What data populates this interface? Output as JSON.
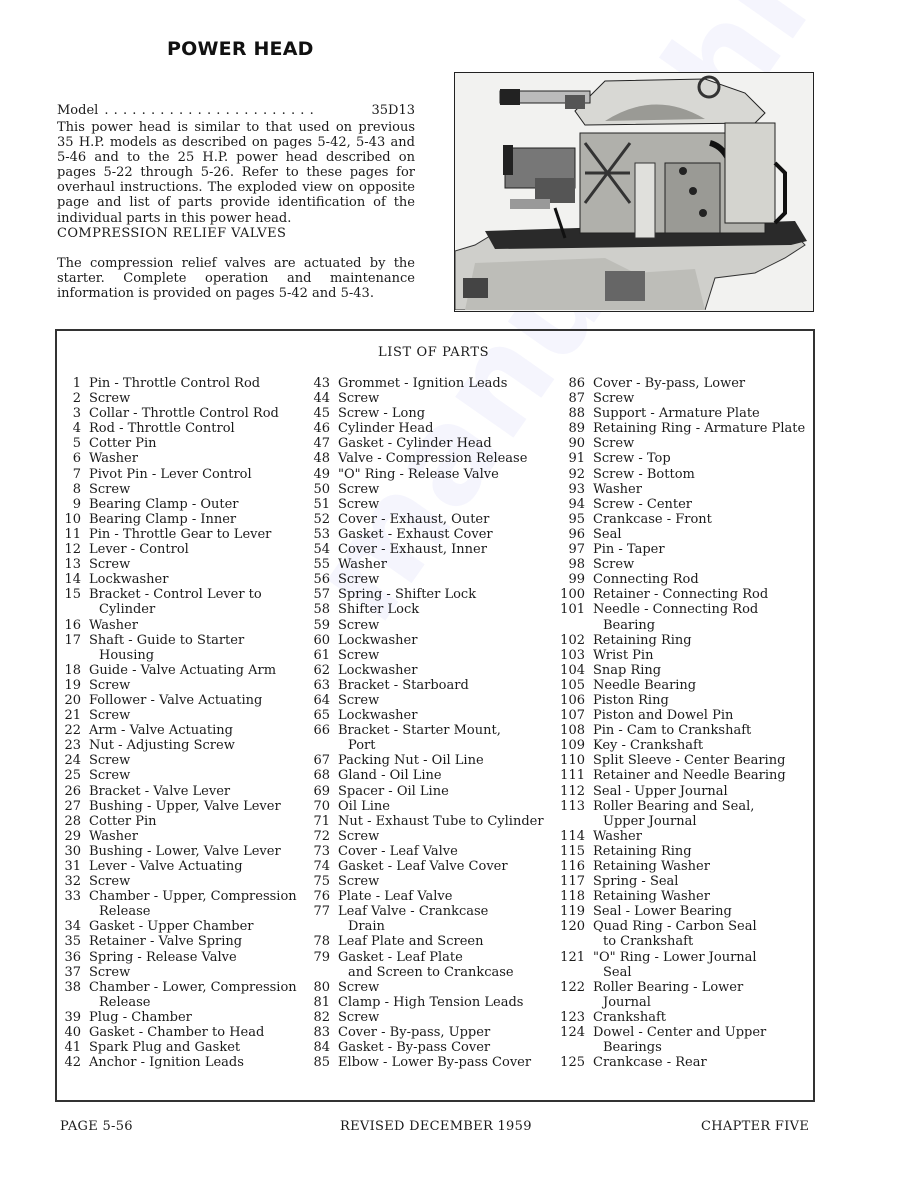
{
  "page": {
    "title": "POWER HEAD",
    "model": {
      "label": "Model",
      "dots": ".......................",
      "value": "35D13"
    },
    "intro_text": "This power head is similar to that used on previous 35 H.P. models as described on pages 5-42, 5-43 and 5-46 and to the 25 H.P. power head described on pages 5-22 through 5-26. Refer to these pages for overhaul instructions. The exploded view on opposite page and list of parts provide identification of the individual parts in this power head.",
    "section": {
      "heading": "COMPRESSION RELIEF VALVES",
      "body": "The compression relief valves are actuated by the starter. Complete operation and maintenance information is provided on pages 5-42 and 5-43."
    },
    "photo": {
      "subject": "outboard-motor-power-head-photo"
    },
    "watermark": "manualshive"
  },
  "parts_list": {
    "title": "LIST OF PARTS",
    "columns": [
      [
        {
          "n": "1",
          "d": "Pin - Throttle Control Rod"
        },
        {
          "n": "2",
          "d": "Screw"
        },
        {
          "n": "3",
          "d": "Collar - Throttle Control Rod"
        },
        {
          "n": "4",
          "d": "Rod - Throttle Control"
        },
        {
          "n": "5",
          "d": "Cotter Pin"
        },
        {
          "n": "6",
          "d": "Washer"
        },
        {
          "n": "7",
          "d": "Pivot Pin - Lever Control"
        },
        {
          "n": "8",
          "d": "Screw"
        },
        {
          "n": "9",
          "d": "Bearing Clamp - Outer"
        },
        {
          "n": "10",
          "d": "Bearing Clamp - Inner"
        },
        {
          "n": "11",
          "d": "Pin - Throttle Gear to Lever"
        },
        {
          "n": "12",
          "d": "Lever - Control"
        },
        {
          "n": "13",
          "d": "Screw"
        },
        {
          "n": "14",
          "d": "Lockwasher"
        },
        {
          "n": "15",
          "d": "Bracket - Control Lever to",
          "c": "Cylinder"
        },
        {
          "n": "16",
          "d": "Washer"
        },
        {
          "n": "17",
          "d": "Shaft - Guide to Starter",
          "c": "Housing"
        },
        {
          "n": "18",
          "d": "Guide - Valve Actuating Arm"
        },
        {
          "n": "19",
          "d": "Screw"
        },
        {
          "n": "20",
          "d": "Follower - Valve Actuating"
        },
        {
          "n": "21",
          "d": "Screw"
        },
        {
          "n": "22",
          "d": "Arm - Valve Actuating"
        },
        {
          "n": "23",
          "d": "Nut - Adjusting Screw"
        },
        {
          "n": "24",
          "d": "Screw"
        },
        {
          "n": "25",
          "d": "Screw"
        },
        {
          "n": "26",
          "d": "Bracket - Valve Lever"
        },
        {
          "n": "27",
          "d": "Bushing - Upper, Valve Lever"
        },
        {
          "n": "28",
          "d": "Cotter Pin"
        },
        {
          "n": "29",
          "d": "Washer"
        },
        {
          "n": "30",
          "d": "Bushing - Lower, Valve Lever"
        },
        {
          "n": "31",
          "d": "Lever - Valve Actuating"
        },
        {
          "n": "32",
          "d": "Screw"
        },
        {
          "n": "33",
          "d": "Chamber - Upper, Compression",
          "c": "Release"
        },
        {
          "n": "34",
          "d": "Gasket - Upper Chamber"
        },
        {
          "n": "35",
          "d": "Retainer - Valve Spring"
        },
        {
          "n": "36",
          "d": "Spring - Release Valve"
        },
        {
          "n": "37",
          "d": "Screw"
        },
        {
          "n": "38",
          "d": "Chamber - Lower, Compression",
          "c": "Release"
        },
        {
          "n": "39",
          "d": "Plug - Chamber"
        },
        {
          "n": "40",
          "d": "Gasket - Chamber to Head"
        },
        {
          "n": "41",
          "d": "Spark Plug and Gasket"
        },
        {
          "n": "42",
          "d": "Anchor - Ignition Leads"
        }
      ],
      [
        {
          "n": "43",
          "d": "Grommet - Ignition Leads"
        },
        {
          "n": "44",
          "d": "Screw"
        },
        {
          "n": "45",
          "d": "Screw - Long"
        },
        {
          "n": "46",
          "d": "Cylinder Head"
        },
        {
          "n": "47",
          "d": "Gasket - Cylinder Head"
        },
        {
          "n": "48",
          "d": "Valve - Compression Release"
        },
        {
          "n": "49",
          "d": "\"O\" Ring - Release Valve"
        },
        {
          "n": "50",
          "d": "Screw"
        },
        {
          "n": "51",
          "d": "Screw"
        },
        {
          "n": "52",
          "d": "Cover - Exhaust, Outer"
        },
        {
          "n": "53",
          "d": "Gasket - Exhaust Cover"
        },
        {
          "n": "54",
          "d": "Cover - Exhaust, Inner"
        },
        {
          "n": "55",
          "d": "Washer"
        },
        {
          "n": "56",
          "d": "Screw"
        },
        {
          "n": "57",
          "d": "Spring - Shifter Lock"
        },
        {
          "n": "58",
          "d": "Shifter Lock"
        },
        {
          "n": "59",
          "d": "Screw"
        },
        {
          "n": "60",
          "d": "Lockwasher"
        },
        {
          "n": "61",
          "d": "Screw"
        },
        {
          "n": "62",
          "d": "Lockwasher"
        },
        {
          "n": "63",
          "d": "Bracket - Starboard"
        },
        {
          "n": "64",
          "d": "Screw"
        },
        {
          "n": "65",
          "d": "Lockwasher"
        },
        {
          "n": "66",
          "d": "Bracket - Starter Mount,",
          "c": "Port"
        },
        {
          "n": "67",
          "d": "Packing Nut - Oil Line"
        },
        {
          "n": "68",
          "d": "Gland - Oil Line"
        },
        {
          "n": "69",
          "d": "Spacer - Oil Line"
        },
        {
          "n": "70",
          "d": "Oil Line"
        },
        {
          "n": "71",
          "d": "Nut - Exhaust Tube to Cylinder"
        },
        {
          "n": "72",
          "d": "Screw"
        },
        {
          "n": "73",
          "d": "Cover - Leaf Valve"
        },
        {
          "n": "74",
          "d": "Gasket - Leaf Valve Cover"
        },
        {
          "n": "75",
          "d": "Screw"
        },
        {
          "n": "76",
          "d": "Plate - Leaf Valve"
        },
        {
          "n": "77",
          "d": "Leaf Valve - Crankcase",
          "c": "Drain"
        },
        {
          "n": "78",
          "d": "Leaf Plate and Screen"
        },
        {
          "n": "79",
          "d": "Gasket - Leaf Plate",
          "c": "and Screen to Crankcase"
        },
        {
          "n": "80",
          "d": "Screw"
        },
        {
          "n": "81",
          "d": "Clamp - High Tension Leads"
        },
        {
          "n": "82",
          "d": "Screw"
        },
        {
          "n": "83",
          "d": "Cover - By-pass, Upper"
        },
        {
          "n": "84",
          "d": "Gasket - By-pass Cover"
        },
        {
          "n": "85",
          "d": "Elbow - Lower By-pass Cover"
        }
      ],
      [
        {
          "n": "86",
          "d": "Cover - By-pass, Lower"
        },
        {
          "n": "87",
          "d": "Screw"
        },
        {
          "n": "88",
          "d": "Support - Armature Plate"
        },
        {
          "n": "89",
          "d": "Retaining Ring - Armature Plate"
        },
        {
          "n": "90",
          "d": "Screw"
        },
        {
          "n": "91",
          "d": "Screw - Top"
        },
        {
          "n": "92",
          "d": "Screw - Bottom"
        },
        {
          "n": "93",
          "d": "Washer"
        },
        {
          "n": "94",
          "d": "Screw - Center"
        },
        {
          "n": "95",
          "d": "Crankcase - Front"
        },
        {
          "n": "96",
          "d": "Seal"
        },
        {
          "n": "97",
          "d": "Pin - Taper"
        },
        {
          "n": "98",
          "d": "Screw"
        },
        {
          "n": "99",
          "d": "Connecting Rod"
        },
        {
          "n": "100",
          "d": "Retainer - Connecting Rod"
        },
        {
          "n": "101",
          "d": "Needle - Connecting Rod",
          "c": "Bearing"
        },
        {
          "n": "102",
          "d": "Retaining Ring"
        },
        {
          "n": "103",
          "d": "Wrist Pin"
        },
        {
          "n": "104",
          "d": "Snap Ring"
        },
        {
          "n": "105",
          "d": "Needle Bearing"
        },
        {
          "n": "106",
          "d": "Piston Ring"
        },
        {
          "n": "107",
          "d": "Piston and Dowel Pin"
        },
        {
          "n": "108",
          "d": "Pin - Cam to Crankshaft"
        },
        {
          "n": "109",
          "d": "Key - Crankshaft"
        },
        {
          "n": "110",
          "d": "Split Sleeve - Center Bearing"
        },
        {
          "n": "111",
          "d": "Retainer and Needle Bearing"
        },
        {
          "n": "112",
          "d": "Seal - Upper Journal"
        },
        {
          "n": "113",
          "d": "Roller Bearing and Seal,",
          "c": "Upper Journal"
        },
        {
          "n": "114",
          "d": "Washer"
        },
        {
          "n": "115",
          "d": "Retaining Ring"
        },
        {
          "n": "116",
          "d": "Retaining Washer"
        },
        {
          "n": "117",
          "d": "Spring - Seal"
        },
        {
          "n": "118",
          "d": "Retaining Washer"
        },
        {
          "n": "119",
          "d": "Seal - Lower Bearing"
        },
        {
          "n": "120",
          "d": "Quad Ring - Carbon Seal",
          "c": "to Crankshaft"
        },
        {
          "n": "121",
          "d": "\"O\" Ring - Lower Journal",
          "c": "Seal"
        },
        {
          "n": "122",
          "d": "Roller Bearing - Lower",
          "c": "Journal"
        },
        {
          "n": "123",
          "d": "Crankshaft"
        },
        {
          "n": "124",
          "d": "Dowel - Center and Upper",
          "c": "Bearings"
        },
        {
          "n": "125",
          "d": "Crankcase - Rear"
        }
      ]
    ]
  },
  "footer": {
    "page": "PAGE 5-56",
    "revision": "REVISED DECEMBER 1959",
    "chapter": "CHAPTER FIVE"
  }
}
